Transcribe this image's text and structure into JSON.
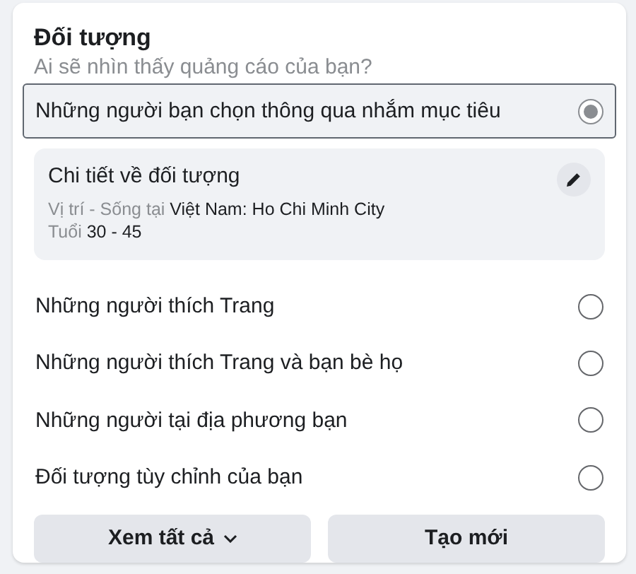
{
  "title": "Đối tượng",
  "subtitle": "Ai sẽ nhìn thấy quảng cáo của bạn?",
  "options": [
    {
      "label": "Những người bạn chọn thông qua nhắm mục tiêu",
      "selected": true
    },
    {
      "label": "Những người thích Trang",
      "selected": false
    },
    {
      "label": "Những người thích Trang và bạn bè họ",
      "selected": false
    },
    {
      "label": "Những người tại địa phương bạn",
      "selected": false
    },
    {
      "label": "Đối tượng tùy chỉnh của bạn",
      "selected": false
    }
  ],
  "details": {
    "title": "Chi tiết về đối tượng",
    "lines": [
      {
        "label": "Vị trí - Sống tại",
        "value": "Việt Nam: Ho Chi Minh City"
      },
      {
        "label": "Tuổi",
        "value": "30 - 45"
      }
    ]
  },
  "buttons": [
    {
      "label": "Xem tất cả",
      "kind": "dropdown"
    },
    {
      "label": "Tạo mới",
      "kind": "plain"
    }
  ]
}
